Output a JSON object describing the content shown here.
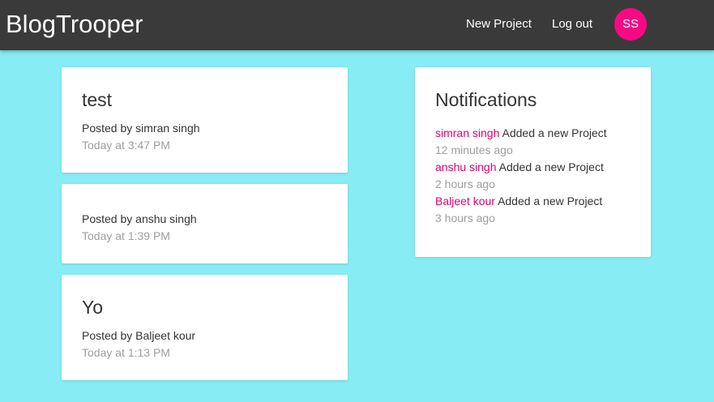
{
  "navbar": {
    "brand": "BlogTrooper",
    "new_project_label": "New Project",
    "logout_label": "Log out",
    "avatar_initials": "SS"
  },
  "projects": [
    {
      "title": "test",
      "author": "Posted by simran singh",
      "time": "Today at 3:47 PM"
    },
    {
      "title": "",
      "author": "Posted by anshu singh",
      "time": "Today at 1:39 PM"
    },
    {
      "title": "Yo",
      "author": "Posted by Baljeet kour",
      "time": "Today at 1:13 PM"
    }
  ],
  "notifications": {
    "title": "Notifications",
    "items": [
      {
        "user": "simran singh",
        "action": "Added a new Project",
        "time": "12 minutes ago"
      },
      {
        "user": "anshu singh",
        "action": "Added a new Project",
        "time": "2 hours ago"
      },
      {
        "user": "Baljeet kour",
        "action": "Added a new Project",
        "time": "3 hours ago"
      }
    ]
  },
  "colors": {
    "page_background": "#87ecf3",
    "navbar_background": "#3b3a3a",
    "avatar_background": "#f50a83",
    "notification_user": "#e5006e"
  }
}
